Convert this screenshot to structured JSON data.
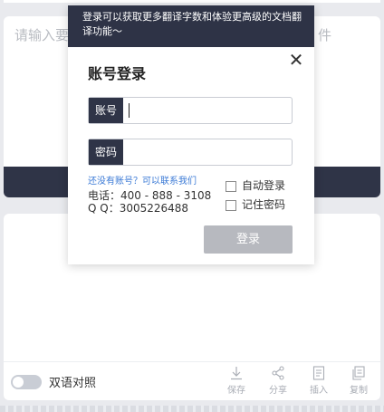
{
  "editor": {
    "input_placeholder_left": "请输入要",
    "input_placeholder_right": "件"
  },
  "login_popup": {
    "banner_text": "登录可以获取更多翻译字数和体验更高级的文档翻译功能～",
    "title": "账号登录",
    "close_glyph": "✕",
    "account_label": "账号",
    "account_value": "",
    "password_label": "密码",
    "password_value": "",
    "contact_link": "还没有账号？可以联系我们",
    "phone": "电话：400 - 888 - 3108",
    "qq": "Q Q：3005226488",
    "auto_login_label": "自动登录",
    "remember_password_label": "记住密码",
    "login_button": "登录"
  },
  "output_panel": {
    "bilingual_toggle_label": "双语对照",
    "bilingual_toggle_on": false,
    "tools": [
      {
        "label": "保存",
        "icon": "download-icon"
      },
      {
        "label": "分享",
        "icon": "share-icon"
      },
      {
        "label": "插入",
        "icon": "insert-doc-icon"
      },
      {
        "label": "复制",
        "icon": "copy-icon"
      }
    ]
  },
  "colors": {
    "dark_header": "#2e3346",
    "link_blue": "#3b7ad6",
    "disabled_button": "#b7b9bf",
    "page_bg": "#e9eaee"
  }
}
